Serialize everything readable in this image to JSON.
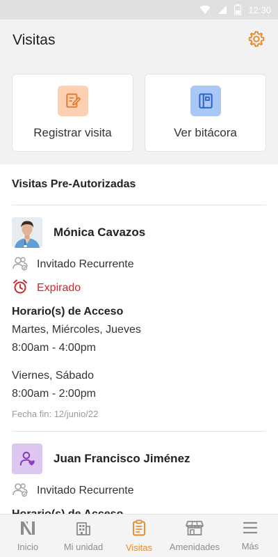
{
  "status_bar": {
    "time": "12:30"
  },
  "header": {
    "title": "Visitas",
    "settings_icon": "gear-icon"
  },
  "actions": [
    {
      "label": "Registrar visita",
      "icon": "edit-note-icon",
      "color": "#fdd0b4"
    },
    {
      "label": "Ver bitácora",
      "icon": "logbook-icon",
      "color": "#a9c8f5"
    }
  ],
  "section": {
    "title": "Visitas Pre-Autorizadas"
  },
  "visits": [
    {
      "name": "Mónica Cavazos",
      "type": "Invitado Recurrente",
      "status": "Expirado",
      "access_title": "Horario(s) de Acceso",
      "schedules": [
        {
          "days": "Martes, Miércoles, Jueves",
          "hours": "8:00am - 4:00pm"
        },
        {
          "days": "Viernes, Sábado",
          "hours": "8:00am - 2:00pm"
        }
      ],
      "end_date": "Fecha fin: 12/junio/22"
    },
    {
      "name": "Juan Francisco Jiménez",
      "type": "Invitado Recurrente",
      "access_title": "Horario(s) de Acceso"
    }
  ],
  "bottom_nav": [
    {
      "label": "Inicio",
      "icon": "home-logo-icon"
    },
    {
      "label": "Mi unidad",
      "icon": "building-icon"
    },
    {
      "label": "Visitas",
      "icon": "clipboard-icon",
      "active": true
    },
    {
      "label": "Amenidades",
      "icon": "store-icon"
    },
    {
      "label": "Más",
      "icon": "menu-icon"
    }
  ],
  "colors": {
    "accent": "#e88a2d",
    "expired": "#d0262e"
  }
}
